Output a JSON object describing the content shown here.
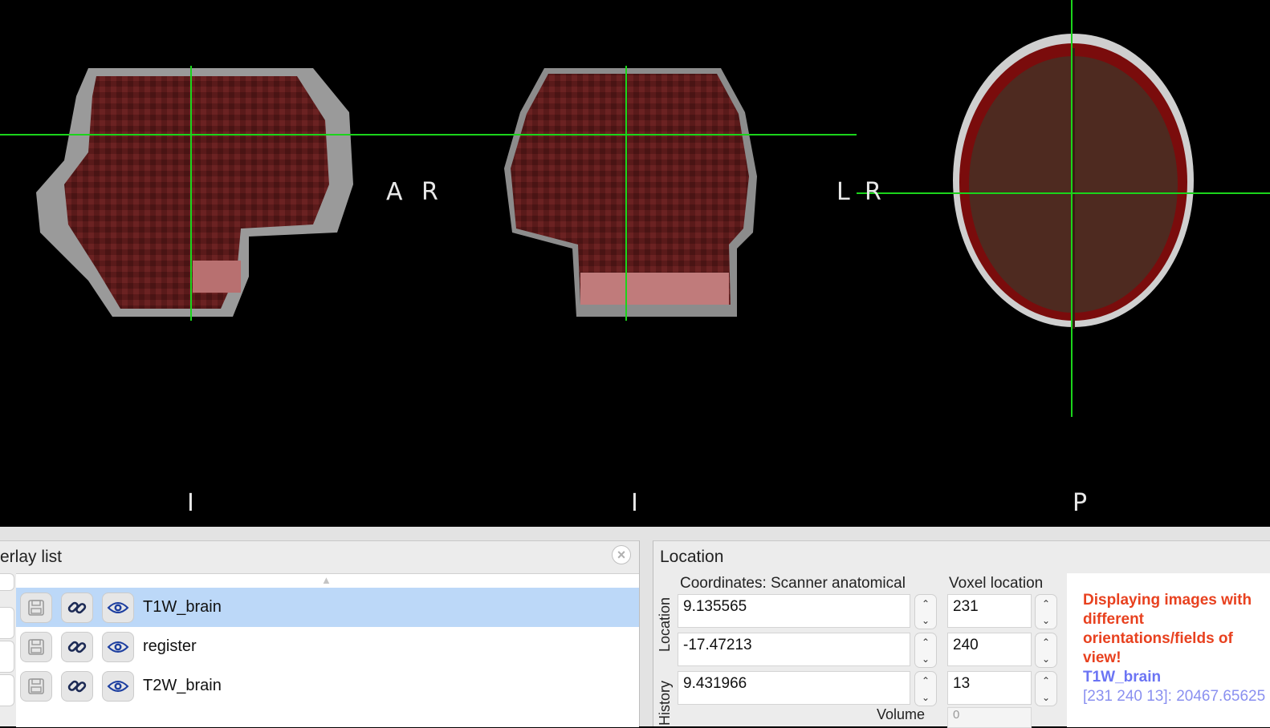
{
  "viewer": {
    "sagittal": {
      "right_label": "A",
      "bottom_label": "I"
    },
    "coronal": {
      "left_label": "R",
      "right_label": "L",
      "bottom_label": "I"
    },
    "axial": {
      "left_label": "R",
      "bottom_label": "P"
    },
    "crosshair_color": "#1bd41b"
  },
  "overlay_list": {
    "title": "erlay list",
    "close_icon": "close-circle-icon",
    "rows": [
      {
        "name": "T1W_brain",
        "selected": true
      },
      {
        "name": "register",
        "selected": false
      },
      {
        "name": "T2W_brain",
        "selected": false
      }
    ]
  },
  "location": {
    "title": "Location",
    "tabs": [
      "Location",
      "History"
    ],
    "coord_header": "Coordinates: Scanner anatomical",
    "voxel_header": "Voxel location",
    "coords": [
      "9.135565",
      "-17.47213",
      "9.431966"
    ],
    "voxels": [
      "231",
      "240",
      "13"
    ],
    "volume_label": "Volume",
    "volume_value": "0",
    "info": {
      "warning": "Displaying images with different orientations/fields of view!",
      "image_name": "T1W_brain",
      "image_value": "[231 240 13]: 20467.65625"
    }
  }
}
